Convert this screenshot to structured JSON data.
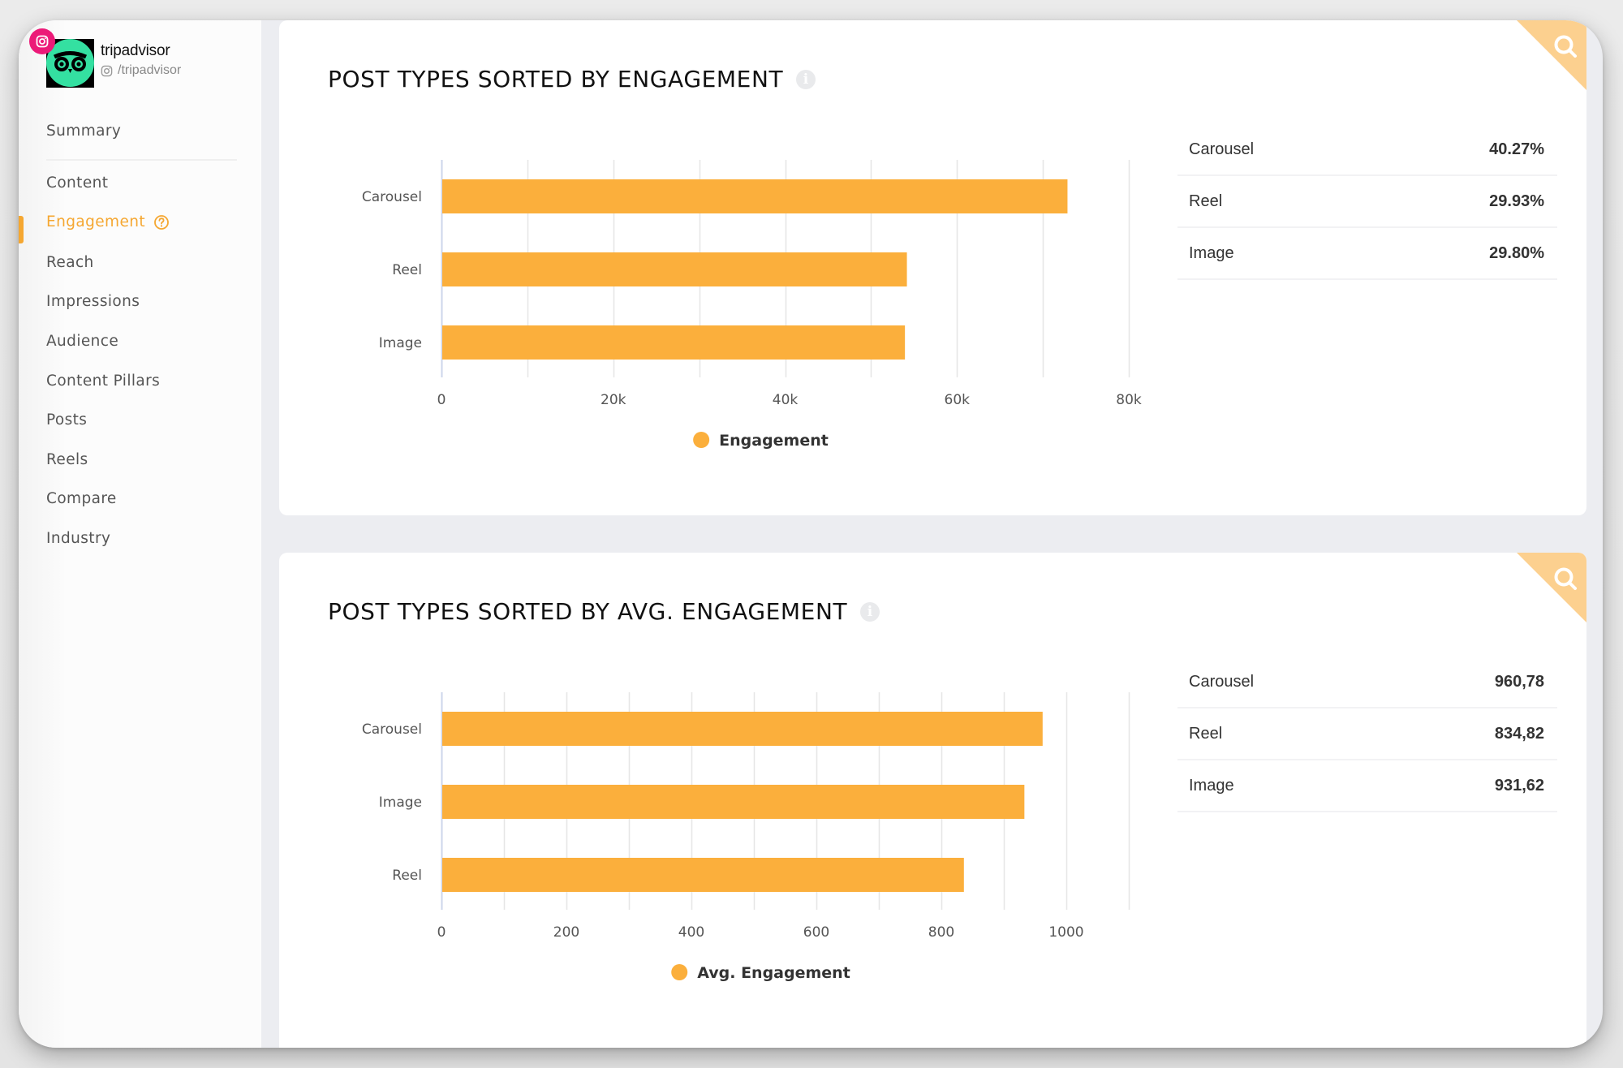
{
  "profile": {
    "name": "tripadvisor",
    "handle": "/tripadvisor",
    "platform_icon": "instagram-icon",
    "brand_color": "#34e0a1",
    "badge_color": "#ec1a78"
  },
  "sidebar": {
    "accent_color": "#f5a731",
    "items": [
      {
        "label": "Summary",
        "active": false
      },
      {
        "label": "Content",
        "active": false
      },
      {
        "label": "Engagement",
        "active": true,
        "icon": "help-circle-icon"
      },
      {
        "label": "Reach",
        "active": false
      },
      {
        "label": "Impressions",
        "active": false
      },
      {
        "label": "Audience",
        "active": false
      },
      {
        "label": "Content Pillars",
        "active": false
      },
      {
        "label": "Posts",
        "active": false
      },
      {
        "label": "Reels",
        "active": false
      },
      {
        "label": "Compare",
        "active": false
      },
      {
        "label": "Industry",
        "active": false
      }
    ]
  },
  "cards": [
    {
      "title": "POST TYPES SORTED BY ENGAGEMENT",
      "info_icon": "info-icon",
      "corner_icon": "search-icon",
      "table": [
        {
          "label": "Carousel",
          "value": "40.27%"
        },
        {
          "label": "Reel",
          "value": "29.93%"
        },
        {
          "label": "Image",
          "value": "29.80%"
        }
      ]
    },
    {
      "title": "POST TYPES SORTED BY AVG. ENGAGEMENT",
      "info_icon": "info-icon",
      "corner_icon": "search-icon",
      "table": [
        {
          "label": "Carousel",
          "value": "960,78"
        },
        {
          "label": "Reel",
          "value": "834,82"
        },
        {
          "label": "Image",
          "value": "931,62"
        }
      ]
    }
  ],
  "chart_data": [
    {
      "type": "bar",
      "orientation": "horizontal",
      "title": "POST TYPES SORTED BY ENGAGEMENT",
      "categories": [
        "Carousel",
        "Reel",
        "Image"
      ],
      "series": [
        {
          "name": "Engagement",
          "values": [
            72770,
            54080,
            53850
          ],
          "color": "#fbaf3c"
        }
      ],
      "xlim": [
        0,
        80000
      ],
      "xticks": [
        0,
        20000,
        40000,
        60000,
        80000
      ],
      "xtick_labels": [
        "0",
        "20k",
        "40k",
        "60k",
        "80k"
      ],
      "grid_step": 10000,
      "grid": true,
      "legend": "bottom-center",
      "xlabel": "",
      "ylabel": ""
    },
    {
      "type": "bar",
      "orientation": "horizontal",
      "title": "POST TYPES SORTED BY AVG. ENGAGEMENT",
      "categories": [
        "Carousel",
        "Image",
        "Reel"
      ],
      "series": [
        {
          "name": "Avg. Engagement",
          "values": [
            960.78,
            931.62,
            834.82
          ],
          "color": "#fbaf3c"
        }
      ],
      "xlim": [
        0,
        1100
      ],
      "xticks": [
        0,
        200,
        400,
        600,
        800,
        1000
      ],
      "xtick_labels": [
        "0",
        "200",
        "400",
        "600",
        "800",
        "1000"
      ],
      "grid_step": 100,
      "grid": true,
      "legend": "bottom-center",
      "xlabel": "",
      "ylabel": ""
    }
  ]
}
